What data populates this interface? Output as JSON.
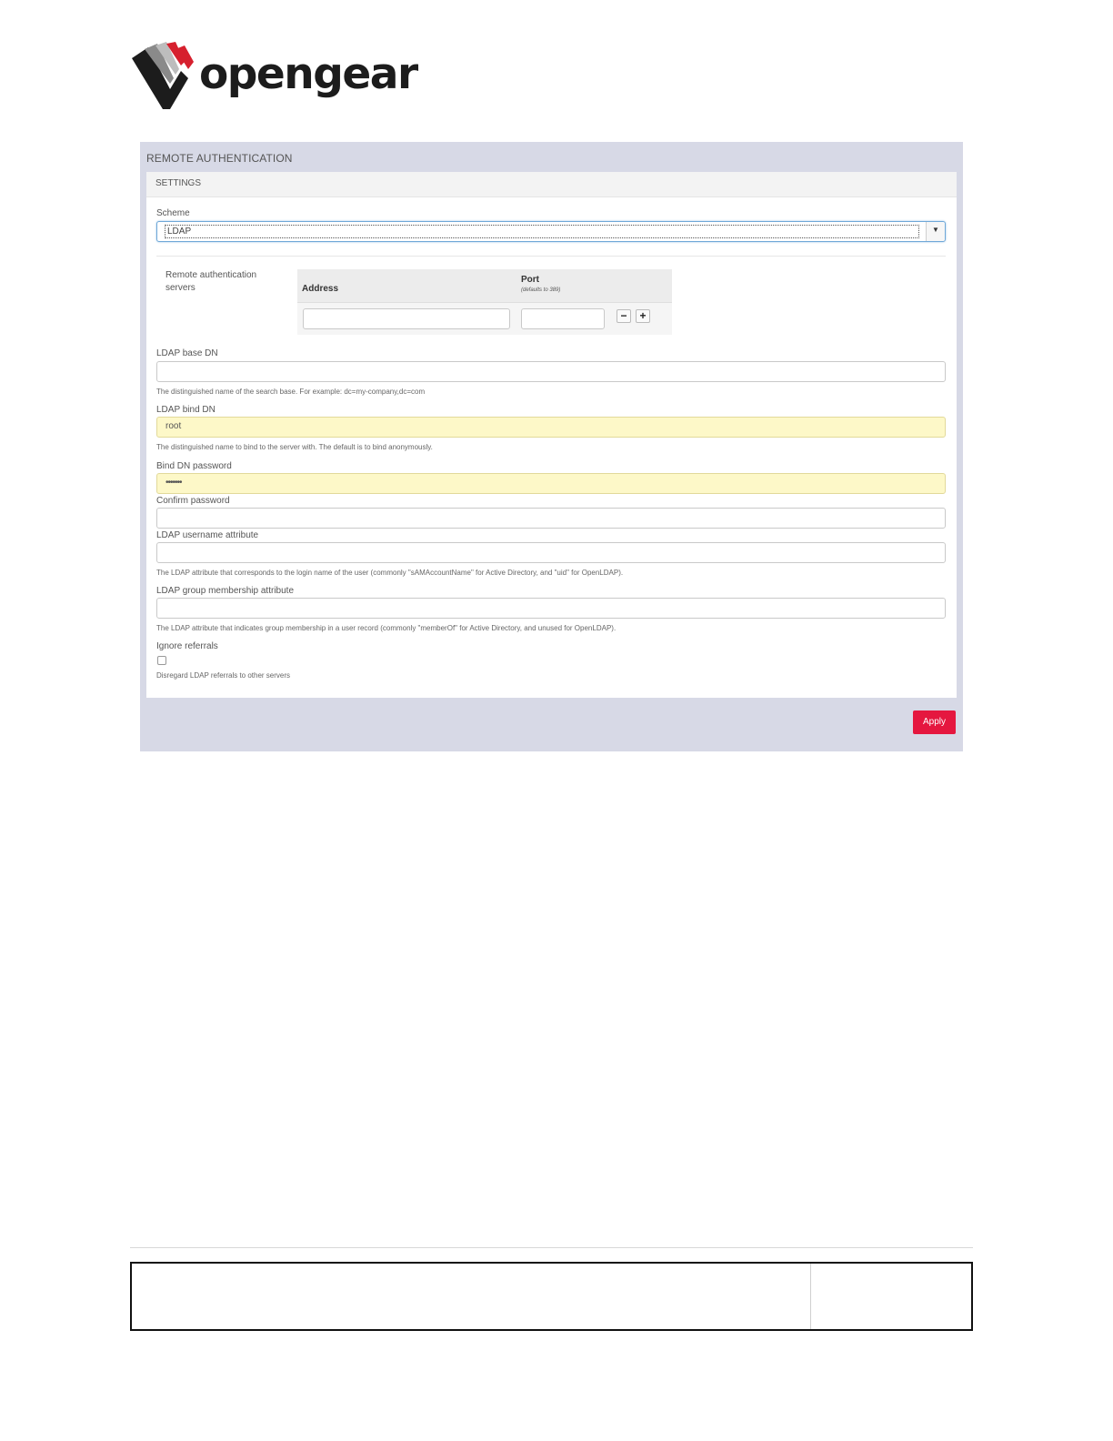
{
  "logo": {
    "text": "opengear",
    "icon": "opengear-chevron-logo"
  },
  "panel": {
    "title": "REMOTE AUTHENTICATION",
    "section": "SETTINGS",
    "scheme": {
      "label": "Scheme",
      "value": "LDAP"
    },
    "servers": {
      "label_line1": "Remote authentication",
      "label_line2": "servers",
      "col_address": "Address",
      "col_port": "Port",
      "col_port_hint": "(defaults to 389)",
      "address_value": "",
      "port_value": "",
      "remove_label": "−",
      "add_label": "+"
    },
    "base_dn": {
      "label": "LDAP base DN",
      "value": "",
      "help": "The distinguished name of the search base. For example: dc=my-company,dc=com"
    },
    "bind_dn": {
      "label": "LDAP bind DN",
      "value": "root",
      "help": "The distinguished name to bind to the server with. The default is to bind anonymously."
    },
    "bind_password": {
      "label": "Bind DN password",
      "value": "•••••••"
    },
    "confirm_password": {
      "label": "Confirm password",
      "value": ""
    },
    "username_attr": {
      "label": "LDAP username attribute",
      "value": "",
      "help": "The LDAP attribute that corresponds to the login name of the user (commonly \"sAMAccountName\" for Active Directory, and \"uid\" for OpenLDAP)."
    },
    "group_attr": {
      "label": "LDAP group membership attribute",
      "value": "",
      "help": "The LDAP attribute that indicates group membership in a user record (commonly \"memberOf\" for Active Directory, and unused for OpenLDAP)."
    },
    "ignore_referrals": {
      "label": "Ignore referrals",
      "checked": false,
      "help": "Disregard LDAP referrals to other servers"
    },
    "apply_label": "Apply"
  },
  "colors": {
    "panel_bg": "#d7d9e6",
    "apply": "#e5173f",
    "filled_field": "#fdf8c8",
    "logo_red": "#d6202e"
  }
}
